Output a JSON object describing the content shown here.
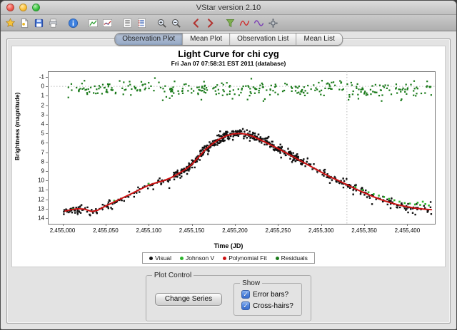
{
  "window": {
    "title": "VStar version 2.10"
  },
  "toolbar": {
    "icons": [
      "new-star-from-database-icon",
      "new-star-from-file-icon",
      "save-icon",
      "print-icon",
      "info-icon",
      "observation-plot-icon",
      "mean-plot-icon",
      "observation-list-icon",
      "mean-list-icon",
      "zoom-in-icon",
      "zoom-out-icon",
      "pan-left-icon",
      "pan-right-icon",
      "filter-icon",
      "polynomial-fit-icon",
      "phase-plot-icon",
      "preferences-icon"
    ]
  },
  "tabs": [
    {
      "label": "Observation Plot",
      "selected": true
    },
    {
      "label": "Mean Plot",
      "selected": false
    },
    {
      "label": "Observation List",
      "selected": false
    },
    {
      "label": "Mean List",
      "selected": false
    }
  ],
  "chart_data": {
    "type": "scatter",
    "title": "Light Curve for chi cyg",
    "subtitle": "Fri Jan 07 07:58:31 EST 2011 (database)",
    "xlabel": "Time (JD)",
    "ylabel": "Brightness (magnitude)",
    "xlim": [
      2454983,
      2455432
    ],
    "ylim": [
      14.6,
      -1.6
    ],
    "x_ticks": [
      2455000,
      2455050,
      2455100,
      2455150,
      2455200,
      2455250,
      2455300,
      2455350,
      2455400
    ],
    "y_ticks": [
      -1,
      0,
      1,
      2,
      3,
      4,
      5,
      6,
      7,
      8,
      9,
      10,
      11,
      12,
      13,
      14
    ],
    "grid": false,
    "legend_position": "bottom",
    "crosshair": {
      "x": 2455330,
      "y": 0.0
    },
    "series": [
      {
        "name": "Visual",
        "type": "scatter",
        "color": "#111111",
        "count": 690,
        "sigma": 0.22,
        "x_range": [
          2455000,
          2455428
        ],
        "dense_range": [
          2455130,
          2455280
        ]
      },
      {
        "name": "Johnson V",
        "type": "scatter",
        "color": "#2db52d",
        "points": [
          [
            2455012,
            13.05
          ],
          [
            2455060,
            12.15
          ],
          [
            2455100,
            10.35
          ],
          [
            2455340,
            10.7
          ],
          [
            2455348,
            11.0
          ],
          [
            2455355,
            11.25
          ],
          [
            2455361,
            11.45
          ],
          [
            2455367,
            11.6
          ],
          [
            2455373,
            11.75
          ],
          [
            2455379,
            11.95
          ],
          [
            2455385,
            12.1
          ],
          [
            2455391,
            12.25
          ],
          [
            2455397,
            12.4
          ],
          [
            2455403,
            12.45
          ],
          [
            2455409,
            12.55
          ],
          [
            2455412,
            12.35
          ],
          [
            2455415,
            12.6
          ],
          [
            2455418,
            12.25
          ],
          [
            2455421,
            12.5
          ],
          [
            2455425,
            12.65
          ]
        ]
      },
      {
        "name": "Polynomial Fit",
        "type": "line",
        "color": "#cc1111"
      },
      {
        "name": "Residuals",
        "type": "scatter",
        "color": "#1a7a1a",
        "count": 330,
        "center": 0.3,
        "sigma": 0.45,
        "x_range": [
          2455005,
          2455428
        ]
      }
    ],
    "fit_curve": [
      [
        2455003,
        13.25
      ],
      [
        2455010,
        13.1
      ],
      [
        2455018,
        13.0
      ],
      [
        2455026,
        13.05
      ],
      [
        2455034,
        13.3
      ],
      [
        2455041,
        13.15
      ],
      [
        2455048,
        12.8
      ],
      [
        2455056,
        12.45
      ],
      [
        2455064,
        12.1
      ],
      [
        2455072,
        11.75
      ],
      [
        2455080,
        11.4
      ],
      [
        2455090,
        10.95
      ],
      [
        2455100,
        10.5
      ],
      [
        2455110,
        10.2
      ],
      [
        2455118,
        10.0
      ],
      [
        2455126,
        9.7
      ],
      [
        2455134,
        9.3
      ],
      [
        2455142,
        8.85
      ],
      [
        2455150,
        8.3
      ],
      [
        2455158,
        7.5
      ],
      [
        2455166,
        6.7
      ],
      [
        2455174,
        6.1
      ],
      [
        2455182,
        5.6
      ],
      [
        2455190,
        5.25
      ],
      [
        2455198,
        5.05
      ],
      [
        2455206,
        5.0
      ],
      [
        2455214,
        5.1
      ],
      [
        2455222,
        5.35
      ],
      [
        2455230,
        5.7
      ],
      [
        2455240,
        6.15
      ],
      [
        2455250,
        6.6
      ],
      [
        2455260,
        7.1
      ],
      [
        2455270,
        7.6
      ],
      [
        2455280,
        8.1
      ],
      [
        2455290,
        8.6
      ],
      [
        2455300,
        9.1
      ],
      [
        2455310,
        9.6
      ],
      [
        2455320,
        10.0
      ],
      [
        2455330,
        10.45
      ],
      [
        2455340,
        10.9
      ],
      [
        2455350,
        11.3
      ],
      [
        2455360,
        11.7
      ],
      [
        2455370,
        12.05
      ],
      [
        2455380,
        12.35
      ],
      [
        2455390,
        12.6
      ],
      [
        2455400,
        12.8
      ],
      [
        2455410,
        12.95
      ],
      [
        2455420,
        13.05
      ],
      [
        2455428,
        13.1
      ]
    ]
  },
  "legend": [
    {
      "label": "Visual",
      "color": "#111111"
    },
    {
      "label": "Johnson V",
      "color": "#2db52d"
    },
    {
      "label": "Polynomial Fit",
      "color": "#cc1111"
    },
    {
      "label": "Residuals",
      "color": "#1a7a1a"
    }
  ],
  "plot_control": {
    "title": "Plot Control",
    "change_series_label": "Change Series",
    "show_title": "Show",
    "checkboxes": [
      {
        "label": "Error bars?",
        "checked": true
      },
      {
        "label": "Cross-hairs?",
        "checked": true
      }
    ]
  }
}
